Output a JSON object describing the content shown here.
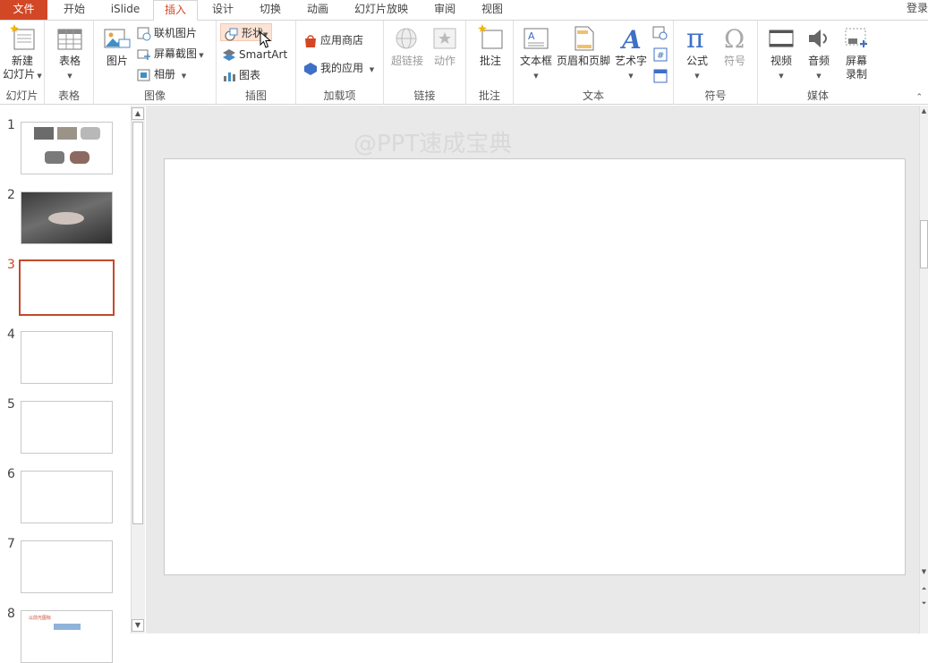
{
  "tabs": [
    "文件",
    "开始",
    "iSlide",
    "插入",
    "设计",
    "切换",
    "动画",
    "幻灯片放映",
    "审阅",
    "视图"
  ],
  "login": "登录",
  "ribbon": {
    "groups": {
      "slides": "幻灯片",
      "tables": "表格",
      "images": "图像",
      "illustrations": "插图",
      "addins": "加载项",
      "links": "链接",
      "comments": "批注",
      "text": "文本",
      "symbols": "符号",
      "media": "媒体"
    },
    "new_slide_line1": "新建",
    "new_slide_line2": "幻灯片",
    "table": "表格",
    "picture": "图片",
    "online_picture": "联机图片",
    "screenshot": "屏幕截图",
    "album": "相册",
    "shapes": "形状",
    "smartart": "SmartArt",
    "chart": "图表",
    "store": "应用商店",
    "my_apps": "我的应用",
    "hyperlink": "超链接",
    "action": "动作",
    "comment": "批注",
    "textbox": "文本框",
    "header_footer": "页眉和页脚",
    "wordart": "艺术字",
    "equation": "公式",
    "symbol": "符号",
    "video": "视频",
    "audio": "音频",
    "screen_record_line1": "屏幕",
    "screen_record_line2": "录制"
  },
  "slides": [
    "1",
    "2",
    "3",
    "4",
    "5",
    "6",
    "7",
    "8"
  ],
  "current_slide": 3,
  "thumb8_title": "以前光图标",
  "watermark": "@PPT速成宝典",
  "colors": {
    "accent": "#d24726",
    "selection": "#c5492a",
    "shape_hover": "#fbe3d5"
  }
}
